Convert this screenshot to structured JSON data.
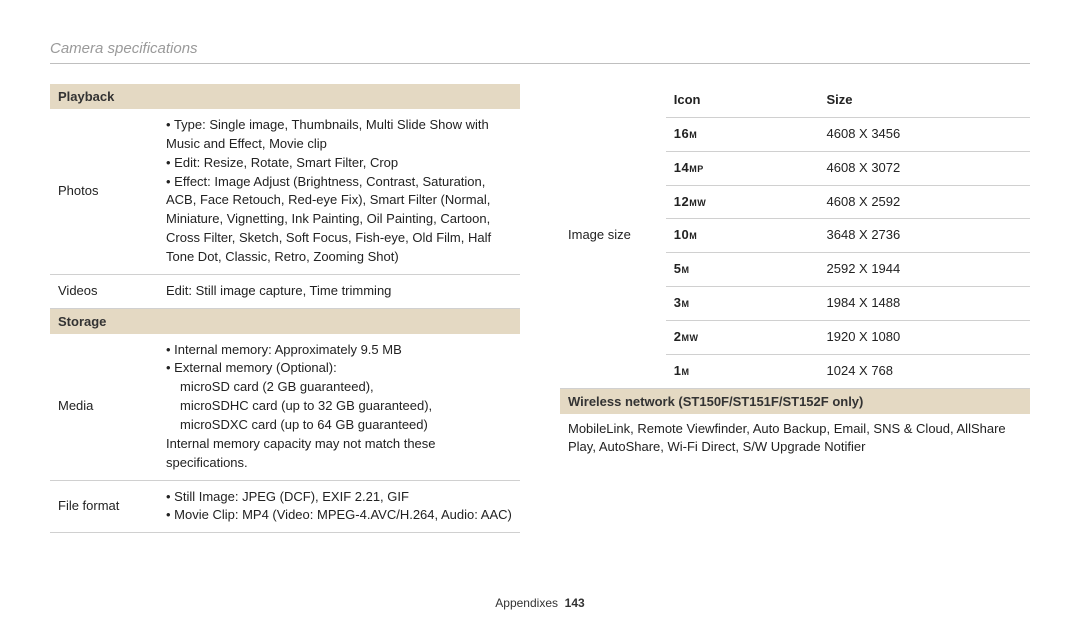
{
  "title": "Camera specifications",
  "footer": {
    "section": "Appendixes",
    "page": "143"
  },
  "left": {
    "playback_header": "Playback",
    "photos_label": "Photos",
    "photos_items": {
      "type_prefix": "Type: Single image, Thumbnails, Multi Slide Show with Music and Effect, Movie clip",
      "edit": "Edit: Resize, Rotate, Smart Filter, Crop",
      "effect": "Effect: Image Adjust (Brightness, Contrast, Saturation, ACB, Face Retouch, Red-eye Fix), Smart Filter (Normal, Miniature, Vignetting, Ink Painting, Oil Painting, Cartoon, Cross Filter, Sketch, Soft Focus, Fish-eye, Old Film, Half Tone Dot, Classic, Retro, Zooming Shot)"
    },
    "videos_label": "Videos",
    "videos_value": "Edit: Still image capture, Time trimming",
    "storage_header": "Storage",
    "media_label": "Media",
    "media_items": {
      "internal": "Internal memory: Approximately 9.5 MB",
      "external_head": "External memory (Optional):",
      "external_sd": "microSD card (2 GB guaranteed),",
      "external_sdhc": "microSDHC card (up to 32 GB guaranteed),",
      "external_sdxc": "microSDXC card (up to 64 GB guaranteed)"
    },
    "media_note": "Internal memory capacity may not match these specifications.",
    "fileformat_label": "File format",
    "fileformat_items": {
      "still": "Still Image: JPEG (DCF), EXIF 2.21, GIF",
      "movie": "Movie Clip: MP4 (Video: MPEG-4.AVC/H.264, Audio: AAC)"
    }
  },
  "right": {
    "imagesize_label": "Image size",
    "header_icon": "Icon",
    "header_size": "Size",
    "rows": [
      {
        "num": "16",
        "suf": "M",
        "size": "4608 X 3456"
      },
      {
        "num": "14",
        "suf": "MP",
        "size": "4608 X 3072"
      },
      {
        "num": "12",
        "suf": "MW",
        "size": "4608 X 2592"
      },
      {
        "num": "10",
        "suf": "M",
        "size": "3648 X 2736"
      },
      {
        "num": "5",
        "suf": "M",
        "size": "2592 X 1944"
      },
      {
        "num": "3",
        "suf": "M",
        "size": "1984 X 1488"
      },
      {
        "num": "2",
        "suf": "MW",
        "size": "1920 X 1080"
      },
      {
        "num": "1",
        "suf": "M",
        "size": "1024 X 768"
      }
    ],
    "wireless_header": "Wireless network (ST150F/ST151F/ST152F only)",
    "wireless_body": "MobileLink, Remote Viewfinder, Auto Backup, Email, SNS & Cloud, AllShare Play, AutoShare, Wi-Fi Direct, S/W Upgrade Notifier"
  }
}
